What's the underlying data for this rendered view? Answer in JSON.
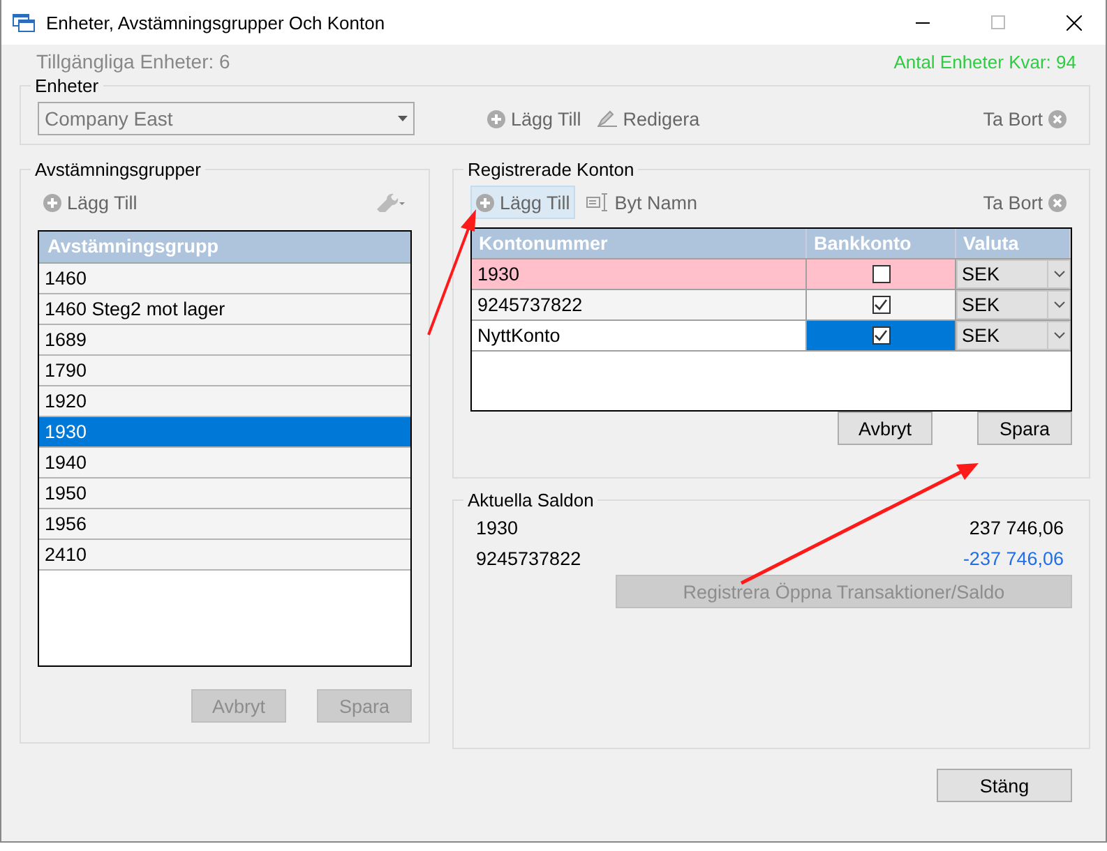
{
  "window": {
    "title": "Enheter, Avstämningsgrupper Och Konton"
  },
  "available_units": "Tillgängliga Enheter: 6",
  "remaining_units": "Antal Enheter Kvar: 94",
  "units": {
    "legend": "Enheter",
    "value": "Company East",
    "add": "Lägg Till",
    "edit": "Redigera",
    "remove": "Ta Bort"
  },
  "groups": {
    "legend": "Avstämningsgrupper",
    "add": "Lägg Till",
    "column": "Avstämningsgrupp",
    "items": [
      {
        "label": "1460",
        "selected": false
      },
      {
        "label": "1460 Steg2 mot lager",
        "selected": false
      },
      {
        "label": "1689",
        "selected": false
      },
      {
        "label": "1790",
        "selected": false
      },
      {
        "label": "1920",
        "selected": false
      },
      {
        "label": "1930",
        "selected": true
      },
      {
        "label": "1940",
        "selected": false
      },
      {
        "label": "1950",
        "selected": false
      },
      {
        "label": "1956",
        "selected": false
      },
      {
        "label": "2410",
        "selected": false
      }
    ],
    "buttons": [
      {
        "label": "Avbryt",
        "disabled": true
      },
      {
        "label": "Spara",
        "disabled": true
      }
    ]
  },
  "accounts": {
    "legend": "Registrerade Konton",
    "add": "Lägg Till",
    "add_hovered": true,
    "rename": "Byt Namn",
    "remove": "Ta Bort",
    "columns": [
      "Kontonummer",
      "Bankkonto",
      "Valuta"
    ],
    "rows": [
      {
        "number": "1930",
        "bank": false,
        "currency": "SEK",
        "invalid": true,
        "selected": false
      },
      {
        "number": "9245737822",
        "bank": true,
        "currency": "SEK",
        "invalid": false,
        "selected": false
      },
      {
        "number": "NyttKonto",
        "bank": true,
        "currency": "SEK",
        "invalid": false,
        "selected": true
      }
    ],
    "buttons": [
      {
        "label": "Avbryt",
        "disabled": false
      },
      {
        "label": "Spara",
        "disabled": false
      }
    ]
  },
  "balances": {
    "legend": "Aktuella Saldon",
    "rows": [
      {
        "account": "1930",
        "amount": "237 746,06",
        "color": "#000000"
      },
      {
        "account": "9245737822",
        "amount": "-237 746,06",
        "color": "#1e6ee8"
      }
    ],
    "register": {
      "label": "Registrera Öppna Transaktioner/Saldo",
      "disabled": true
    }
  },
  "close": "Stäng"
}
